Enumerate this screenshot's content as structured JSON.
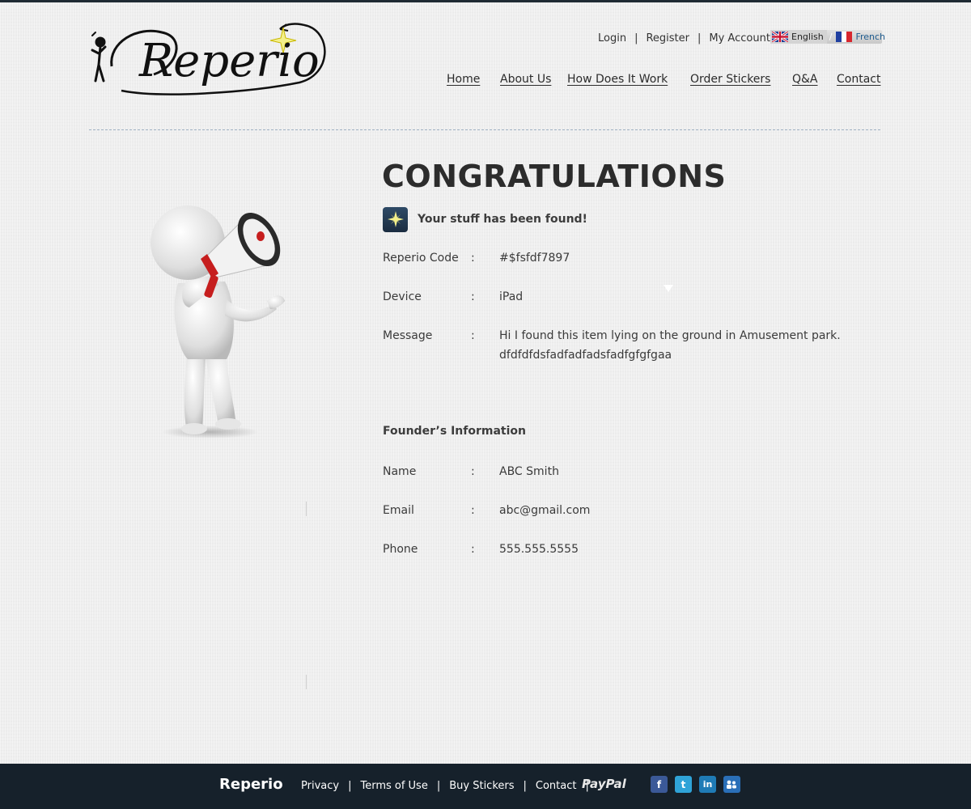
{
  "brand": {
    "logo_text": "Reperio"
  },
  "header": {
    "top_links": [
      {
        "label": "Login"
      },
      {
        "label": "Register"
      },
      {
        "label": "My Account"
      }
    ],
    "languages": [
      {
        "label": "English",
        "flag": "uk-flag-icon"
      },
      {
        "label": "French",
        "flag": "france-flag-icon"
      }
    ],
    "nav": [
      {
        "label": "Home"
      },
      {
        "label": "About Us"
      },
      {
        "label": "How Does It Work"
      },
      {
        "label": "Order Stickers"
      },
      {
        "label": "Q&A"
      },
      {
        "label": "Contact"
      }
    ]
  },
  "main": {
    "title": "CONGRATULATIONS",
    "found_message": "Your stuff has been found!",
    "colon": ":",
    "item_fields": [
      {
        "label": "Reperio Code",
        "value": "#$fsfdf7897"
      },
      {
        "label": "Device",
        "value": "iPad"
      },
      {
        "label": "Message",
        "value": "Hi I found this item lying on the ground in Amusement park. dfdfdfdsfadfadfadsfadfgfgfgaa"
      }
    ],
    "founder_section_title": "Founder’s Information",
    "founder_fields": [
      {
        "label": "Name",
        "value": "ABC Smith"
      },
      {
        "label": "Email",
        "value": "abc@gmail.com"
      },
      {
        "label": "Phone",
        "value": "555.555.5555"
      }
    ]
  },
  "footer": {
    "brand": "Reperio",
    "links": [
      {
        "label": "Privacy"
      },
      {
        "label": "Terms of Use"
      },
      {
        "label": "Buy Stickers"
      },
      {
        "label": "Contact"
      }
    ],
    "paypal": "PayPal",
    "social": [
      {
        "name": "facebook-icon",
        "color": "#3b5998"
      },
      {
        "name": "twitter-icon",
        "color": "#2fa3d8"
      },
      {
        "name": "linkedin-icon",
        "color": "#1f7bb6"
      },
      {
        "name": "myspace-icon",
        "color": "#2a6fb8"
      }
    ]
  },
  "colors": {
    "footer_bg": "#16212b",
    "accent_star": "#f4f08a"
  }
}
